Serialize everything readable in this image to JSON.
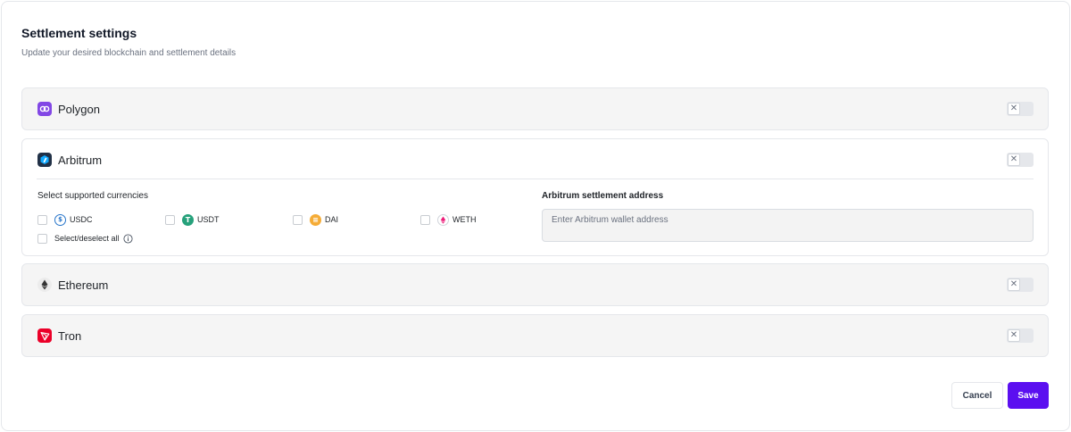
{
  "header": {
    "title": "Settlement settings",
    "subtitle": "Update your desired blockchain and settlement details"
  },
  "chains": [
    {
      "name": "Polygon",
      "icon": "polygon-icon",
      "color": "#8247e5",
      "enabled": false,
      "expanded": false
    },
    {
      "name": "Arbitrum",
      "icon": "arbitrum-icon",
      "color": "#213147",
      "enabled": false,
      "expanded": true
    },
    {
      "name": "Ethereum",
      "icon": "ethereum-icon",
      "color": "#ececec",
      "enabled": false,
      "expanded": false
    },
    {
      "name": "Tron",
      "icon": "tron-icon",
      "color": "#eb0029",
      "enabled": false,
      "expanded": false
    }
  ],
  "arbitrum": {
    "currencies_label": "Select supported currencies",
    "currencies": [
      {
        "label": "USDC",
        "icon": "usdc-icon",
        "color": "#2775ca",
        "checked": false
      },
      {
        "label": "USDT",
        "icon": "usdt-icon",
        "color": "#26a17b",
        "checked": false
      },
      {
        "label": "DAI",
        "icon": "dai-icon",
        "color": "#f5ac37",
        "checked": false
      },
      {
        "label": "WETH",
        "icon": "weth-icon",
        "color": "#ec1c79",
        "checked": false
      }
    ],
    "select_all_label": "Select/deselect all",
    "address_label": "Arbitrum settlement address",
    "address_placeholder": "Enter Arbitrum wallet address",
    "address_value": ""
  },
  "toggle_off_glyph": "✕",
  "footer": {
    "cancel_label": "Cancel",
    "save_label": "Save",
    "accent": "#5b0ff0"
  }
}
